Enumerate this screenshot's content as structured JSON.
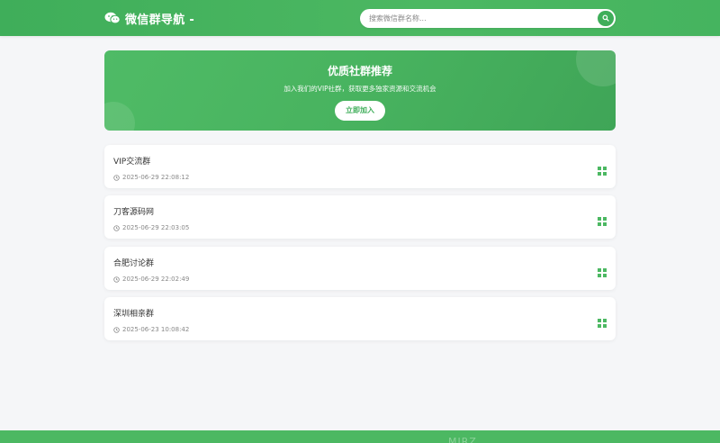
{
  "header": {
    "site_title": "微信群导航 -",
    "search_placeholder": "搜索微信群名称..."
  },
  "hero": {
    "title": "优质社群推荐",
    "subtitle": "加入我们的VIP社群，获取更多独家资源和交流机会",
    "join_label": "立即加入"
  },
  "groups": [
    {
      "name": "VIP交流群",
      "time": "2025-06-29 22:08:12"
    },
    {
      "name": "刀客源码网",
      "time": "2025-06-29 22:03:05"
    },
    {
      "name": "合肥讨论群",
      "time": "2025-06-29 22:02:49"
    },
    {
      "name": "深圳相亲群",
      "time": "2025-06-23 10:08:42"
    }
  ],
  "footer": {
    "partial_text": "MJRZ"
  },
  "colors": {
    "brand_green": "#3fae5a",
    "background": "#f5f6f8"
  },
  "icons": {
    "brand": "wechat-icon",
    "search": "search-icon",
    "time": "clock-icon",
    "card_action": "qrcode-icon"
  }
}
